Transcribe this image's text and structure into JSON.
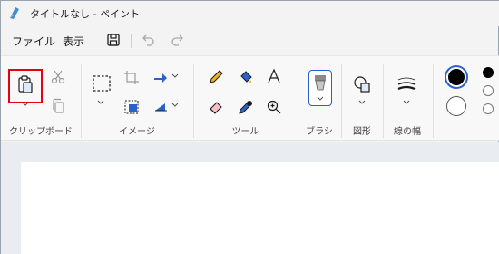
{
  "window": {
    "title": "タイトルなし - ペイント"
  },
  "menu": {
    "file": "ファイル",
    "view": "表示"
  },
  "ribbon": {
    "groups": [
      {
        "label": "クリップボード"
      },
      {
        "label": "イメージ"
      },
      {
        "label": "ツール"
      },
      {
        "label": "ブラシ"
      },
      {
        "label": "図形"
      },
      {
        "label": "線の幅"
      }
    ]
  },
  "colors": {
    "accent": "#2a62c9",
    "highlight": "#e60012",
    "primary": "#000000",
    "secondary": "#ffffff"
  },
  "icons": [
    "paste-icon",
    "cut-icon",
    "copy-icon",
    "select-icon",
    "crop-icon",
    "resize-icon",
    "rotate-icon",
    "flip-icon",
    "pencil-icon",
    "fill-icon",
    "text-icon",
    "eraser-icon",
    "color-picker-icon",
    "magnifier-icon",
    "brush-icon",
    "shapes-icon",
    "line-width-icon",
    "save-icon",
    "undo-icon",
    "redo-icon"
  ]
}
